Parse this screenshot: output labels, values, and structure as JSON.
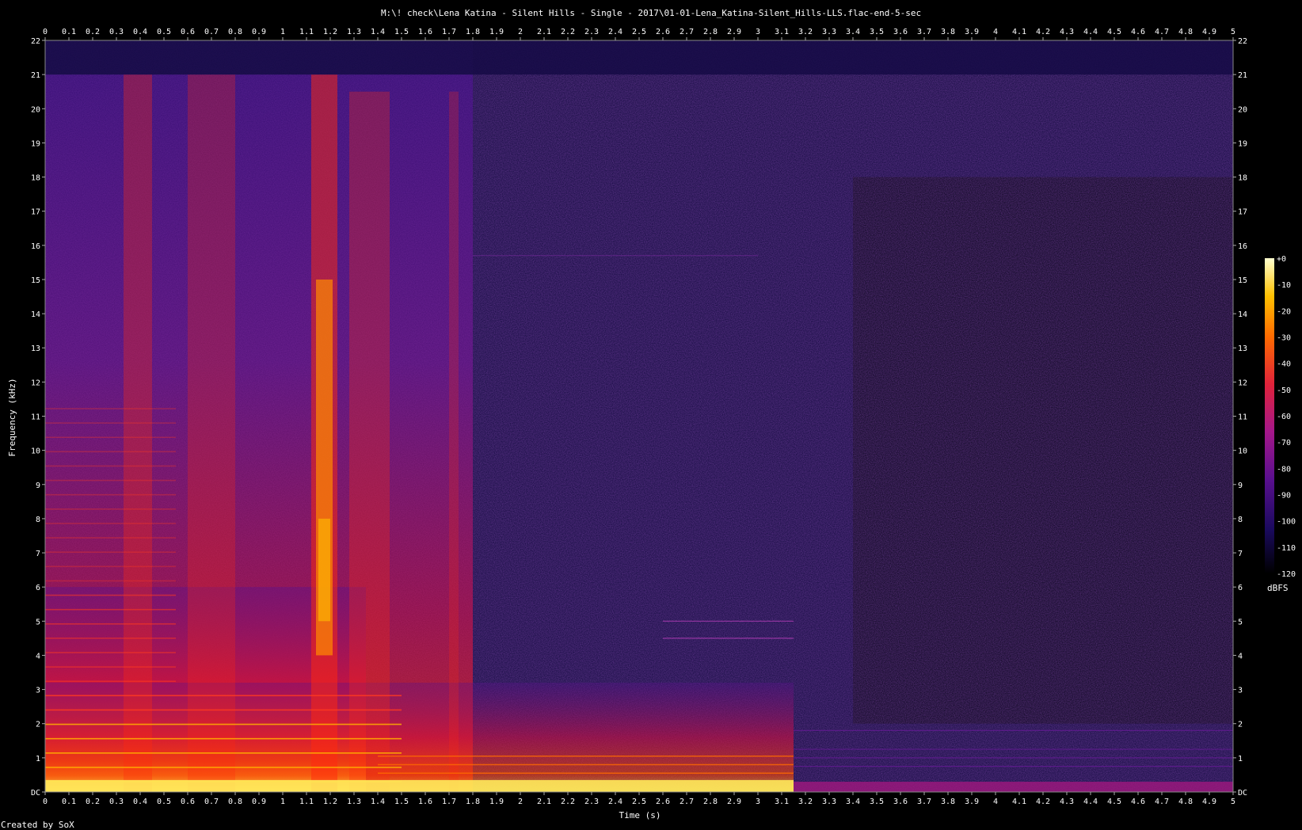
{
  "title": "M:\\! check\\Lena Katina - Silent Hills - Single - 2017\\01-01-Lena_Katina-Silent_Hills-LLS.flac-end-5-sec",
  "footer": "Created by SoX",
  "chart_data": {
    "type": "heatmap",
    "xlabel": "Time (s)",
    "ylabel": "Frequency (kHz)",
    "xlim": [
      0,
      5
    ],
    "ylim": [
      0,
      22
    ],
    "x_ticks": [
      "0",
      "0.1",
      "0.2",
      "0.3",
      "0.4",
      "0.5",
      "0.6",
      "0.7",
      "0.8",
      "0.9",
      "1",
      "1.1",
      "1.2",
      "1.3",
      "1.4",
      "1.5",
      "1.6",
      "1.7",
      "1.8",
      "1.9",
      "2",
      "2.1",
      "2.2",
      "2.3",
      "2.4",
      "2.5",
      "2.6",
      "2.7",
      "2.8",
      "2.9",
      "3",
      "3.1",
      "3.2",
      "3.3",
      "3.4",
      "3.5",
      "3.6",
      "3.7",
      "3.8",
      "3.9",
      "4",
      "4.1",
      "4.2",
      "4.3",
      "4.4",
      "4.5",
      "4.6",
      "4.7",
      "4.8",
      "4.9",
      "5"
    ],
    "y_ticks": [
      "DC",
      "1",
      "2",
      "3",
      "4",
      "5",
      "6",
      "7",
      "8",
      "9",
      "10",
      "11",
      "12",
      "13",
      "14",
      "15",
      "16",
      "17",
      "18",
      "19",
      "20",
      "21",
      "22"
    ],
    "colorbar": {
      "label": "dBFS",
      "ticks": [
        "+0",
        "-10",
        "-20",
        "-30",
        "-40",
        "-50",
        "-60",
        "-70",
        "-80",
        "-90",
        "-100",
        "-110",
        "-120"
      ],
      "range": [
        -120,
        0
      ],
      "colors": [
        "#000000",
        "#1a0a5e",
        "#5a0f8f",
        "#a5178a",
        "#e0223a",
        "#ff6a00",
        "#ffc000",
        "#ffffd0"
      ]
    },
    "features": {
      "bandlimit_khz": 21,
      "music_end_s": 1.8,
      "loud_end_s": 3.15,
      "transients_s": [
        0.34,
        1.18,
        1.3,
        1.72
      ],
      "horizontal_line_khz": 15.7
    }
  }
}
